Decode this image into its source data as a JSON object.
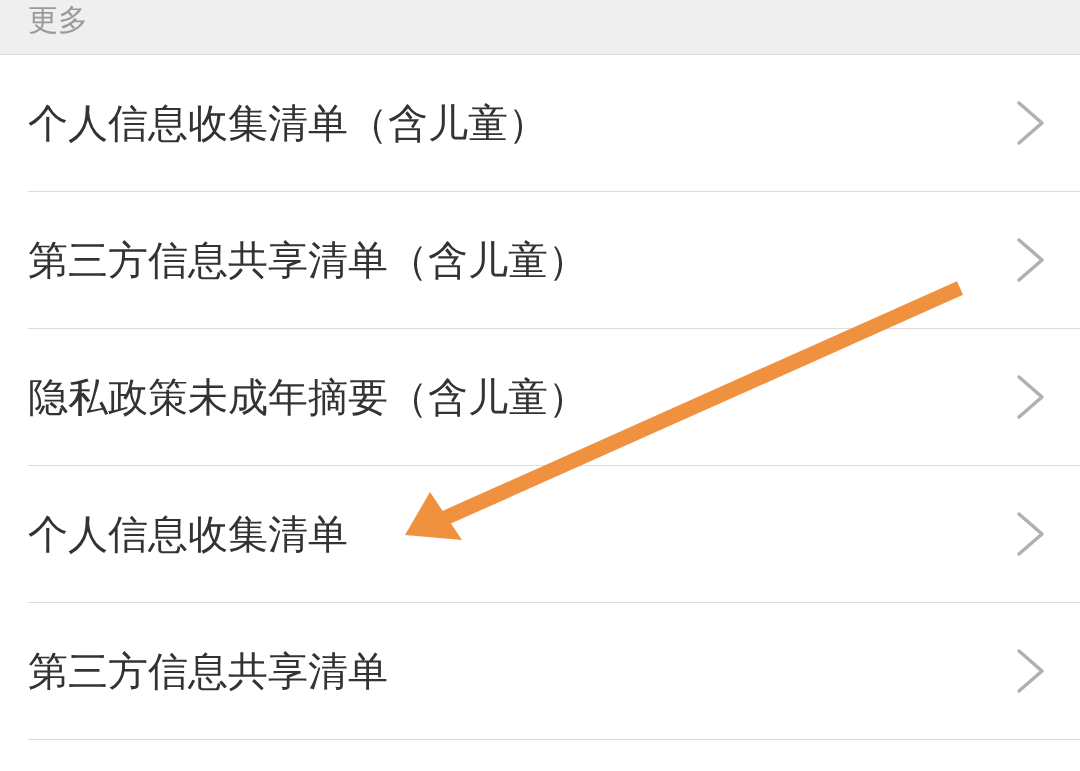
{
  "header": {
    "title": "更多"
  },
  "items": [
    {
      "label": "个人信息收集清单（含儿童）"
    },
    {
      "label": "第三方信息共享清单（含儿童）"
    },
    {
      "label": "隐私政策未成年摘要（含儿童）"
    },
    {
      "label": "个人信息收集清单"
    },
    {
      "label": "第三方信息共享清单"
    }
  ]
}
